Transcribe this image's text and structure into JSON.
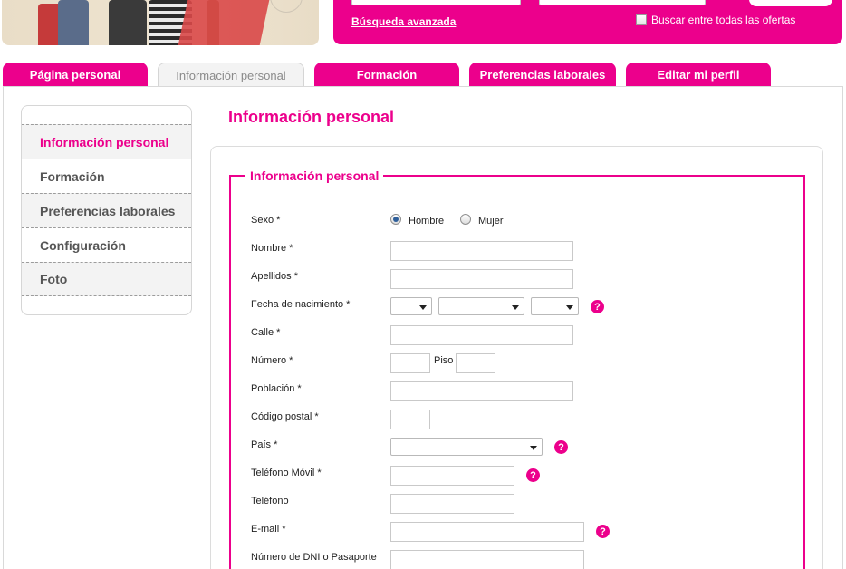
{
  "header": {
    "search": {
      "keyword_value": "",
      "advanced_link": "Búsqueda avanzada",
      "all_offers_label": "Buscar entre todas las ofertas"
    }
  },
  "tabs": [
    {
      "label": "Página personal"
    },
    {
      "label": "Información personal"
    },
    {
      "label": "Formación"
    },
    {
      "label": "Preferencias laborales"
    },
    {
      "label": "Editar mi perfil"
    }
  ],
  "sidebar": {
    "items": [
      {
        "label": "Información personal"
      },
      {
        "label": "Formación"
      },
      {
        "label": "Preferencias laborales"
      },
      {
        "label": "Configuración"
      },
      {
        "label": "Foto"
      }
    ]
  },
  "page": {
    "title": "Información personal",
    "section_legend": "Información personal"
  },
  "form": {
    "sexo": "Sexo *",
    "hombre": "Hombre",
    "mujer": "Mujer",
    "nombre": "Nombre *",
    "apellidos": "Apellidos *",
    "fecha": "Fecha de nacimiento *",
    "calle": "Calle *",
    "numero": "Número *",
    "piso": "Piso",
    "poblacion": "Población *",
    "cp": "Código postal *",
    "pais": "País *",
    "movil": "Teléfono Móvil *",
    "telefono": "Teléfono",
    "email": "E-mail *",
    "dni": "Número de DNI o Pasaporte"
  },
  "icons": {
    "help": "?"
  },
  "colors": {
    "accent": "#ec008c"
  }
}
